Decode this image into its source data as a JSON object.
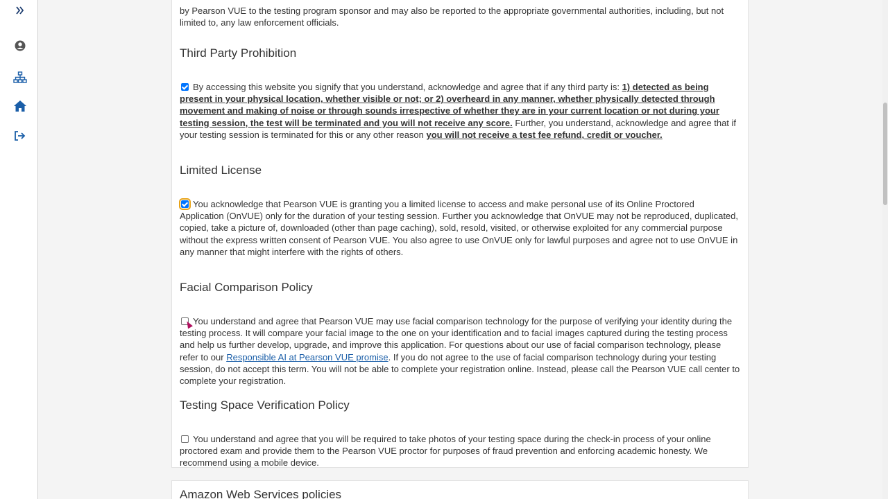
{
  "sidebar": {
    "icons": [
      "expand-icon",
      "user-icon",
      "sitemap-icon",
      "home-icon",
      "sign-out-icon"
    ]
  },
  "intro_text": "by Pearson VUE to the testing program sponsor and may also be reported to the appropriate governmental authorities, including, but not limited to, any law enforcement officials.",
  "sections": {
    "third_party": {
      "title": "Third Party Prohibition",
      "checked": true,
      "text_1": "By accessing this website you signify that you understand, acknowledge and agree that if any third party is: ",
      "bold_1": "1) detected as being present in your physical location, whether visible or not; or 2) overheard in any manner, whether physically detected through movement and making of noise or through sounds irrespective of whether they are in your current location or not during your testing session, the test will be terminated and you will not receive any score.",
      "text_2": " Further, you understand, acknowledge and agree that if your testing session is terminated for this or any other reason ",
      "bold_2": "you will not receive a test fee refund, credit or voucher."
    },
    "limited_license": {
      "title": "Limited License",
      "checked": true,
      "text": "You acknowledge that Pearson VUE is granting you a limited license to access and make personal use of its Online Proctored Application (OnVUE) only for the duration of your testing session. Further you acknowledge that OnVUE may not be reproduced, duplicated, copied, take a picture of, downloaded (other than page caching), sold, resold, visited, or otherwise exploited for any commercial purpose without the express written consent of Pearson VUE. You also agree to use OnVUE only for lawful purposes and agree not to use OnVUE in any manner that might interfere with the rights of others."
    },
    "facial": {
      "title": "Facial Comparison Policy",
      "checked": false,
      "text_1": "You understand and agree that Pearson VUE may use facial comparison technology for the purpose of verifying your identity during the testing process. It will compare your facial image to the one on your identification and to facial images captured during the testing process and help us further develop, upgrade, and improve this application. For questions about our use of facial comparison technology, please refer to our ",
      "link": "Responsible AI at Pearson VUE promise",
      "text_2": ". If you do not agree to the use of facial comparison technology during your testing session, do not accept this term. You will not be able to complete your registration online. Instead, please call the Pearson VUE call center to complete your registration."
    },
    "testing_space": {
      "title": "Testing Space Verification Policy",
      "checked": false,
      "text": "You understand and agree that you will be required to take photos of your testing space during the check-in process of your online proctored exam and provide them to the Pearson VUE proctor for purposes of fraud prevention and enforcing academic honesty. We recommend using a mobile device."
    },
    "aws": {
      "title": "Amazon Web Services policies"
    }
  }
}
